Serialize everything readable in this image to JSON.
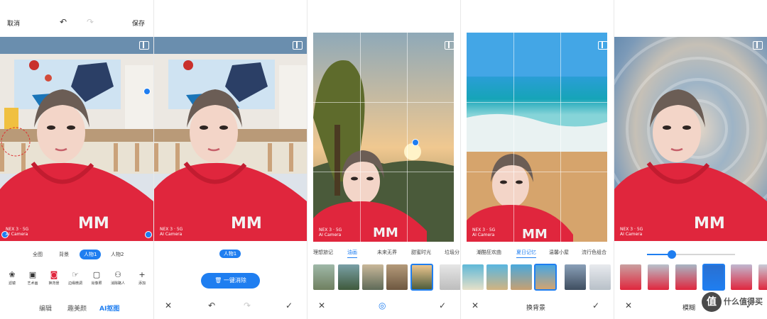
{
  "panel1": {
    "cancel": "取消",
    "undo_icon": "undo-icon",
    "redo_icon": "redo-icon",
    "save": "保存",
    "watermark_line1": "NEX 3 · 5G",
    "watermark_line2": "AI Camera",
    "segments": [
      "全图",
      "背景",
      "人物1",
      "人物2"
    ],
    "active_segment": "人物1",
    "tools": [
      {
        "label": "滤镜",
        "icon": "filter-icon"
      },
      {
        "label": "艺术画",
        "icon": "art-icon"
      },
      {
        "label": "换背景",
        "icon": "background-icon"
      },
      {
        "label": "边缘微调",
        "icon": "edge-icon"
      },
      {
        "label": "肖像照",
        "icon": "portrait-icon"
      },
      {
        "label": "消除路人",
        "icon": "erase-person-icon"
      },
      {
        "label": "添加",
        "icon": "add-icon"
      }
    ],
    "bottom_tabs": [
      "编辑",
      "趣美颜",
      "AI抠图"
    ],
    "active_tab": "AI抠图"
  },
  "panel2": {
    "person_pill": "人物1",
    "clear_button": "一键消除",
    "watermark_line1": "NEX 3 · 5G",
    "watermark_line2": "AI Camera"
  },
  "panel3": {
    "categories": [
      "理想旅记",
      "油画",
      "未来无界",
      "甜蜜时光",
      "垃圾分"
    ],
    "active_category": "油画",
    "watermark_line1": "NEX 3 · 5G",
    "watermark_line2": "AI Camera"
  },
  "panel4": {
    "categories": [
      "潮酷狂欢曲",
      "夏日记忆",
      "温馨小屋",
      "流行色组合"
    ],
    "active_category": "夏日记忆",
    "title": "换背景",
    "watermark_line1": "NEX 3 · 5G",
    "watermark_line2": "AI Camera"
  },
  "panel5": {
    "blur_level_fraction": 0.28,
    "title": "模糊",
    "watermark_line1": "NEX 3 · 5G",
    "watermark_line2": "AI Camera",
    "logo_glyph": "值",
    "logo_text_line1": "什么值得买"
  },
  "colors": {
    "accent": "#1f7ef0",
    "hoodie": "#e0263d"
  }
}
